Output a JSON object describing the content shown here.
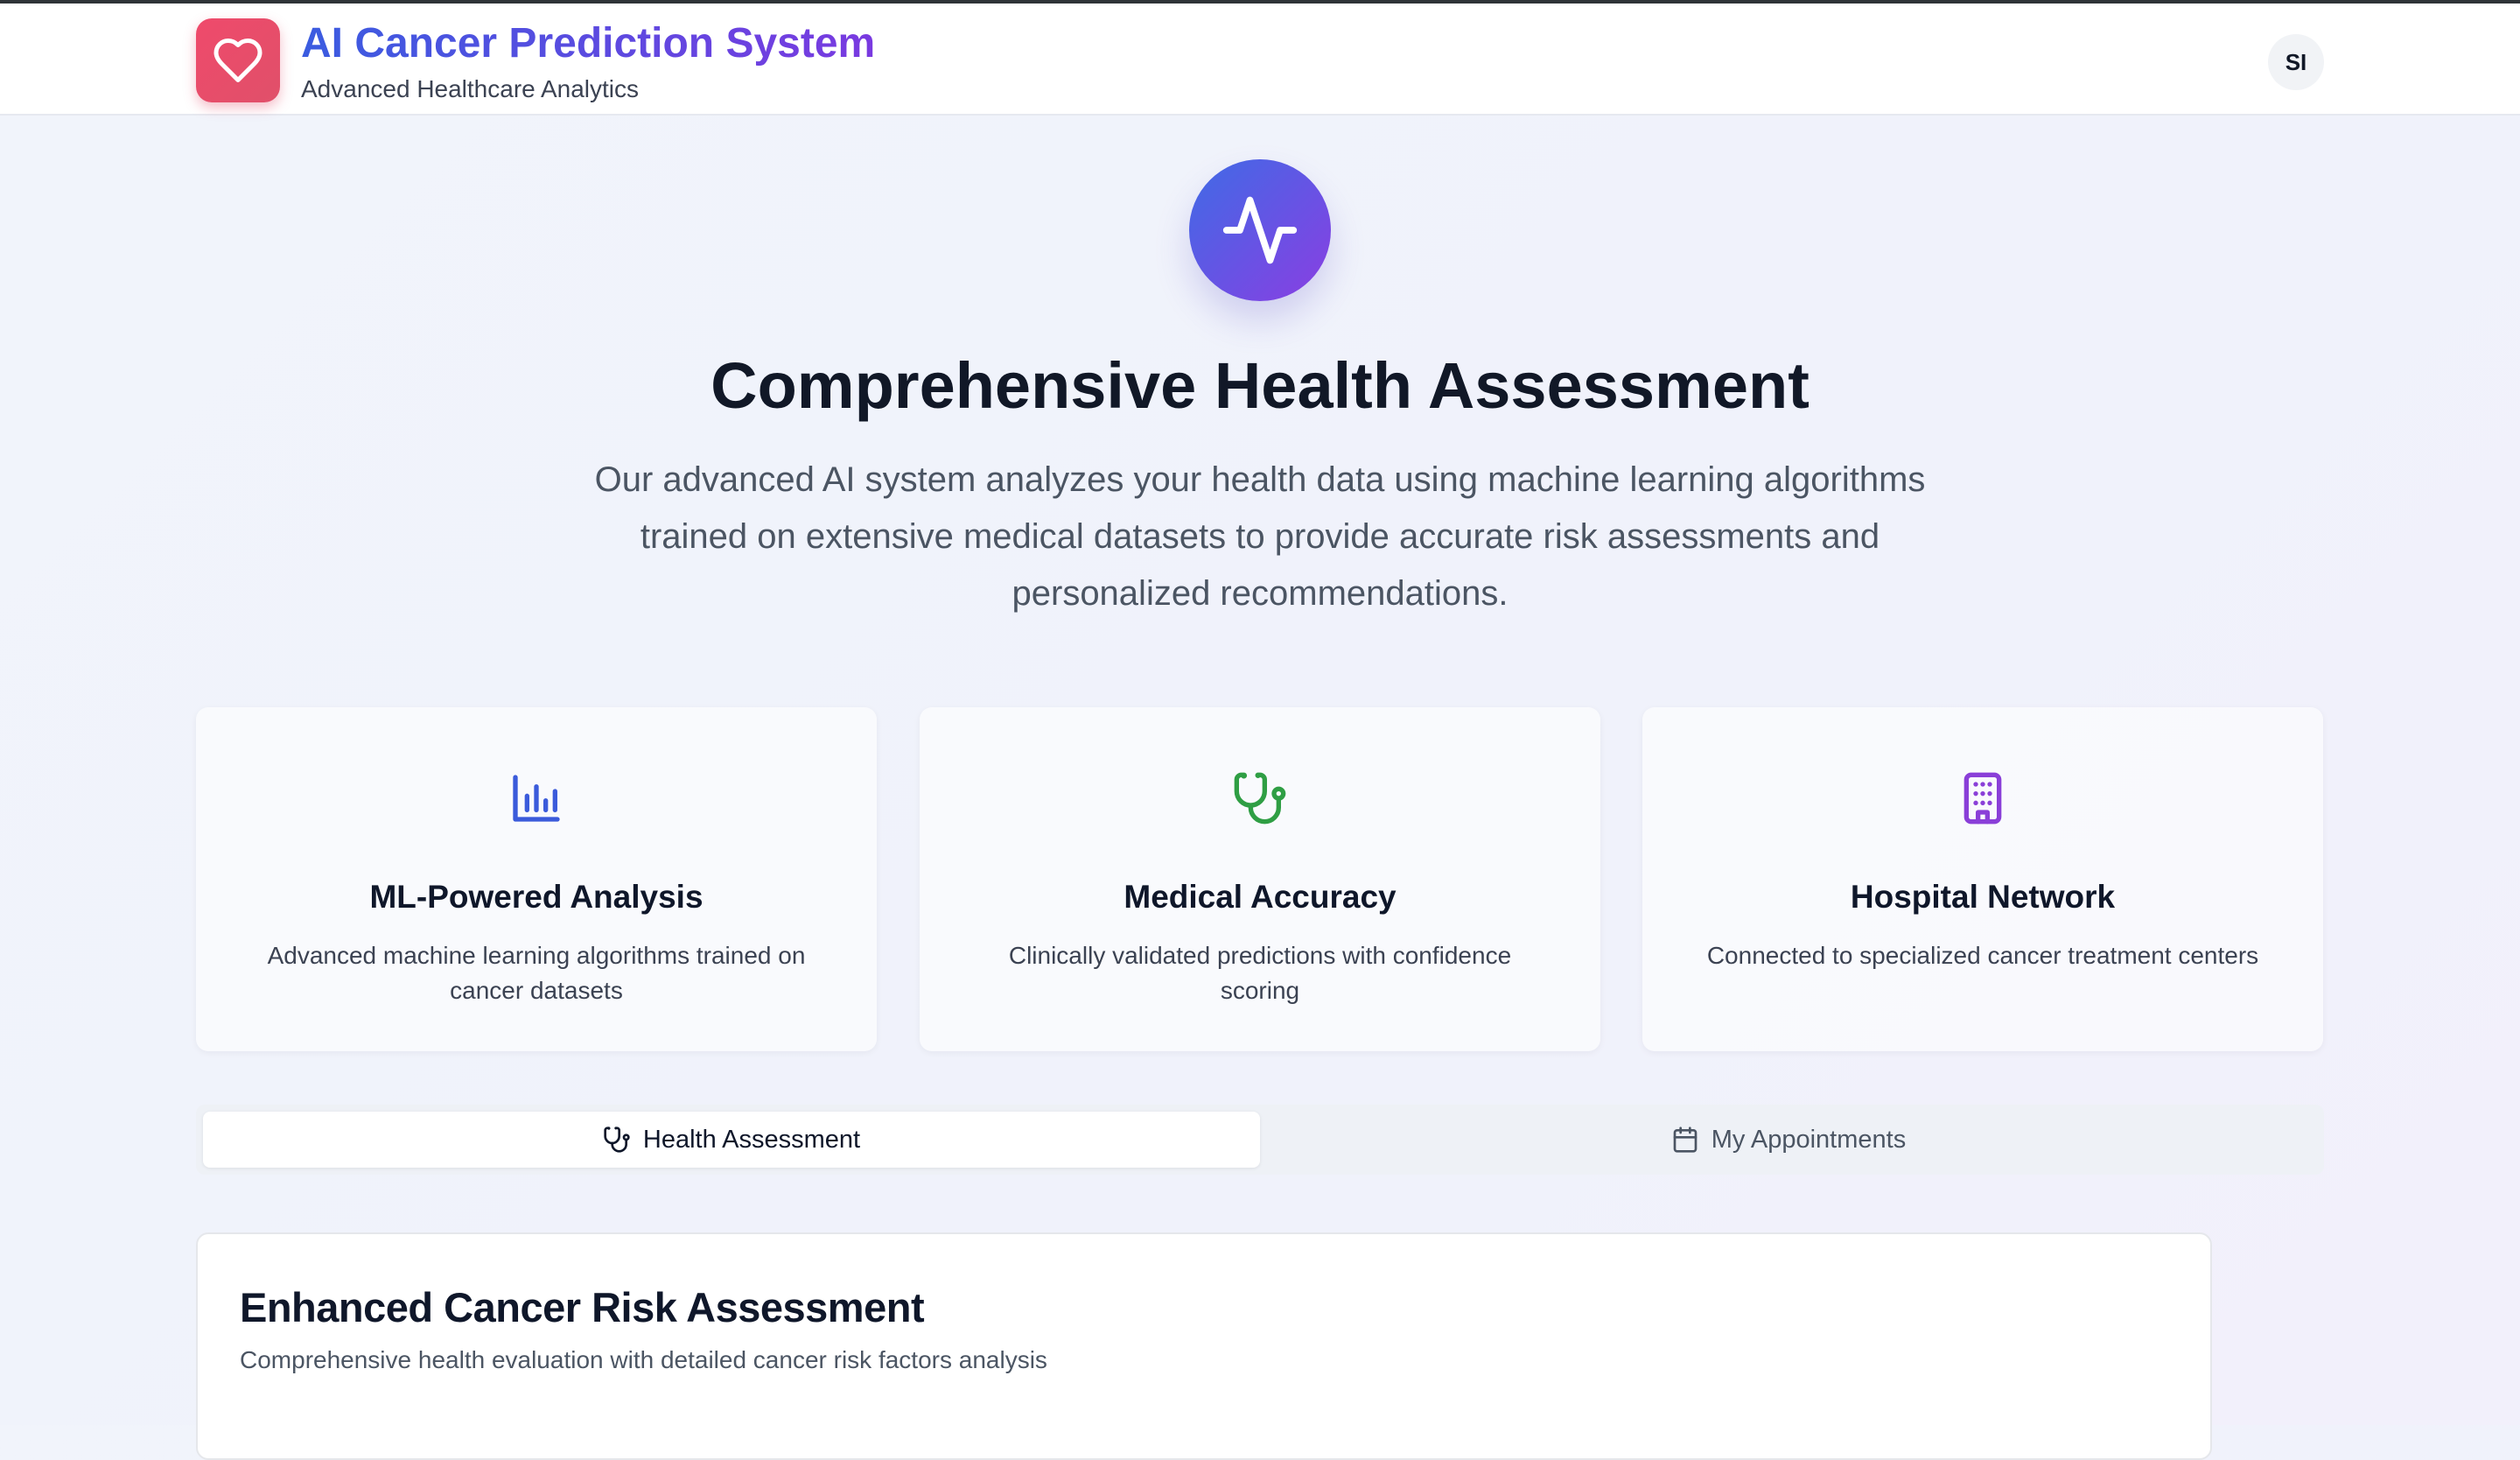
{
  "header": {
    "app_title": "AI Cancer Prediction System",
    "app_subtitle": "Advanced Healthcare Analytics",
    "user_initials": "SI",
    "logo_icon": "heart-icon"
  },
  "hero": {
    "icon": "activity-pulse-icon",
    "title": "Comprehensive Health Assessment",
    "description": "Our advanced AI system analyzes your health data using machine learning algorithms trained on extensive medical datasets to provide accurate risk assessments and personalized recommendations."
  },
  "features": [
    {
      "icon": "bar-chart-icon",
      "title": "ML-Powered Analysis",
      "description": "Advanced machine learning algorithms trained on cancer datasets",
      "color": "#3b5bdb"
    },
    {
      "icon": "stethoscope-icon",
      "title": "Medical Accuracy",
      "description": "Clinically validated predictions with confidence scoring",
      "color": "#2f9e44"
    },
    {
      "icon": "hospital-building-icon",
      "title": "Hospital Network",
      "description": "Connected to specialized cancer treatment centers",
      "color": "#8a3fd8"
    }
  ],
  "tabs": [
    {
      "label": "Health Assessment",
      "icon": "stethoscope-icon",
      "active": true
    },
    {
      "label": "My Appointments",
      "icon": "calendar-icon",
      "active": false
    }
  ],
  "panel": {
    "title": "Enhanced Cancer Risk Assessment",
    "subtitle": "Comprehensive health evaluation with detailed cancer risk factors analysis"
  },
  "colors": {
    "brand_gradient_start": "#3a5ce0",
    "brand_gradient_end": "#7a3ae0",
    "logo_bg": "#ef4a6b"
  }
}
